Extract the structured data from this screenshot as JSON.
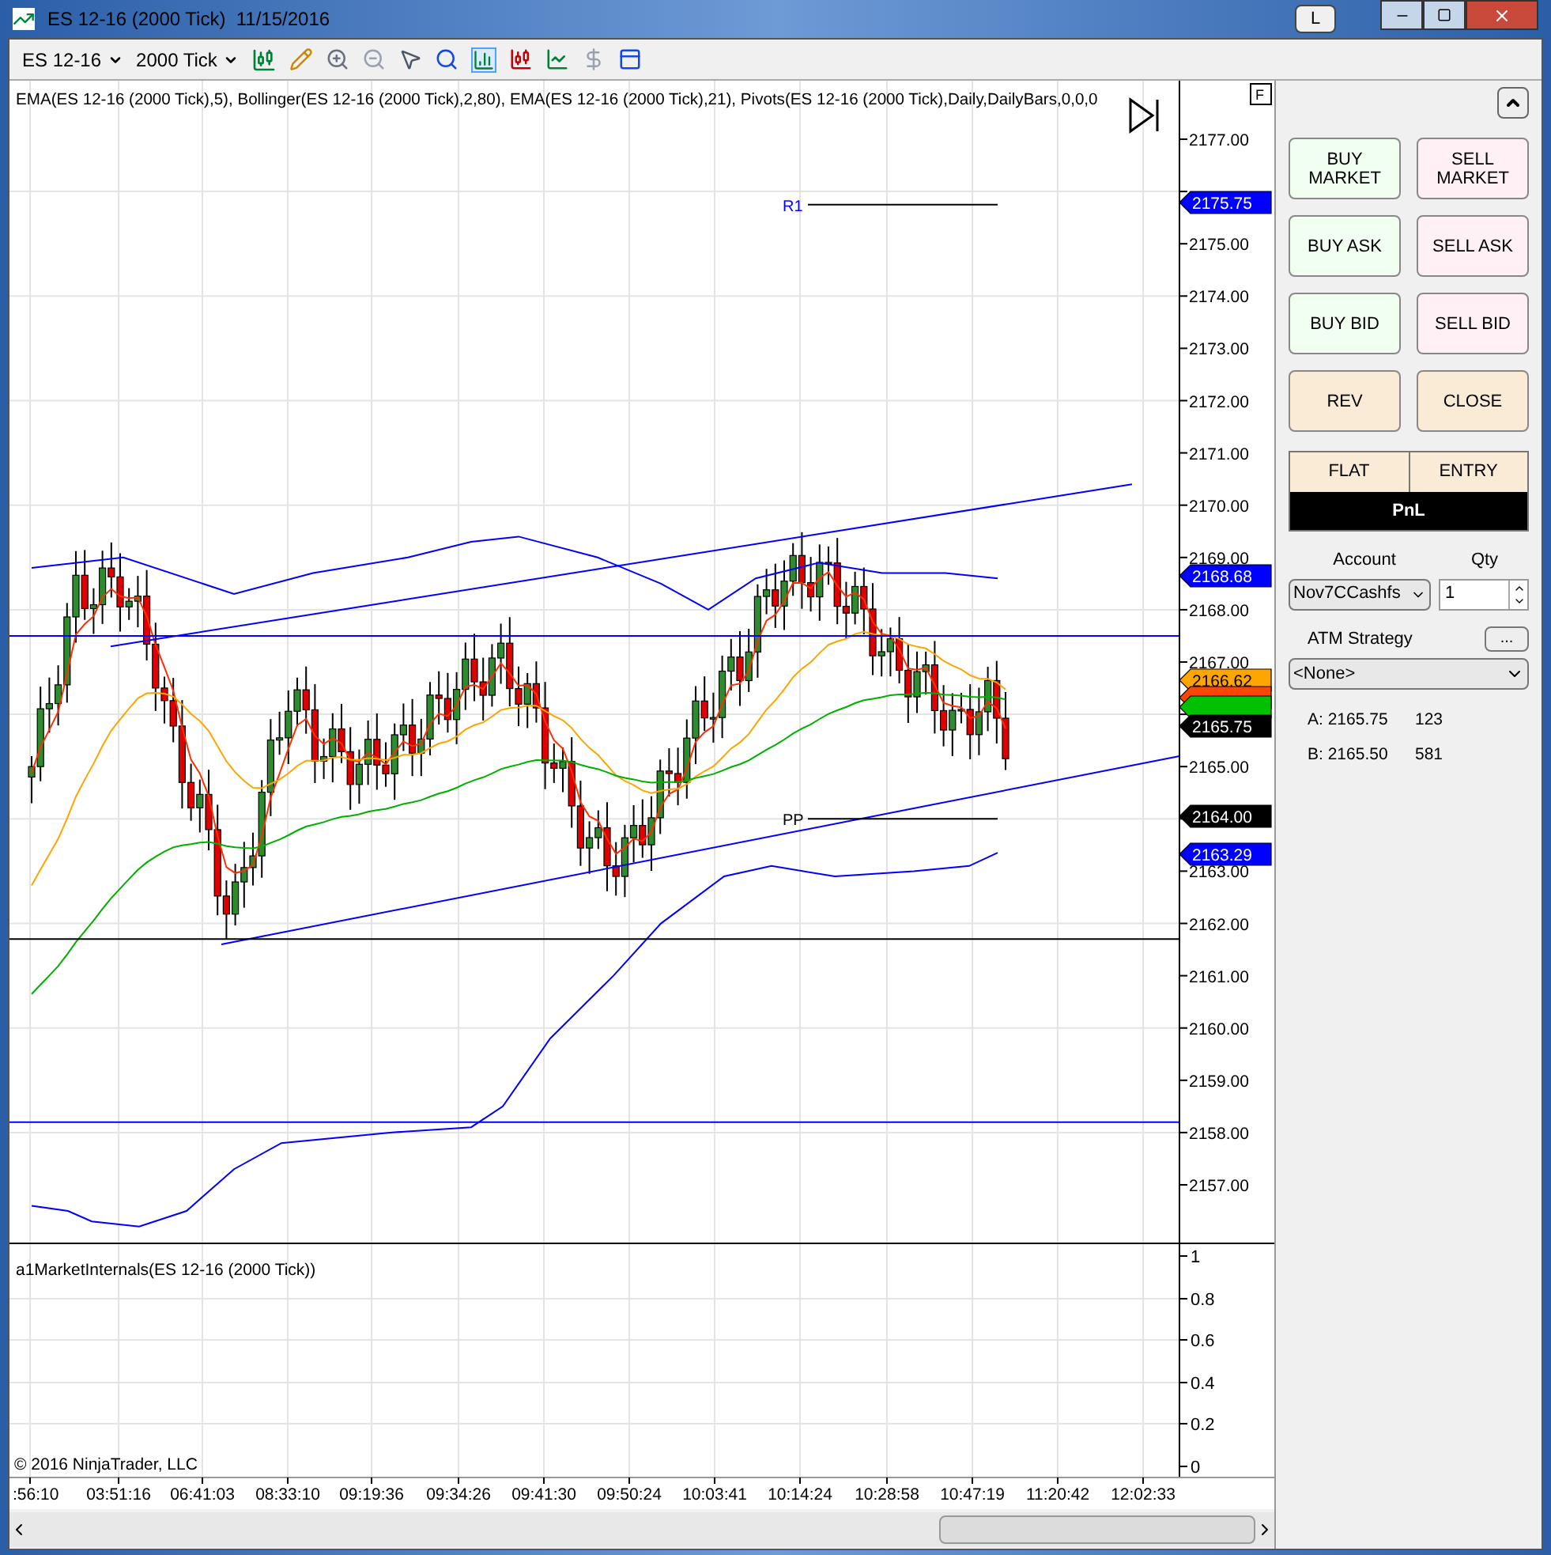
{
  "window": {
    "title": "ES 12-16 (2000 Tick)  11/15/2016",
    "layout_button": "L"
  },
  "toolbar": {
    "instrument": "ES 12-16",
    "interval": "2000 Tick"
  },
  "chart": {
    "indicators": "EMA(ES 12-16 (2000 Tick),5), Bollinger(ES 12-16 (2000 Tick),2,80), EMA(ES 12-16 (2000 Tick),21), Pivots(ES 12-16 (2000 Tick),Daily,DailyBars,0,0,0",
    "f_button": "F",
    "price_labels": [
      "2177.00",
      "2175.00",
      "2174.00",
      "2173.00",
      "2172.00",
      "2171.00",
      "2170.00",
      "2169.00",
      "2168.00",
      "2167.00",
      "2165.00",
      "2163.00",
      "2162.00",
      "2161.00",
      "2160.00",
      "2159.00",
      "2158.00",
      "2157.00"
    ],
    "price_tags": [
      {
        "text": "2175.75",
        "color": "#0000ff"
      },
      {
        "text": "2168.68",
        "color": "#0000ff"
      },
      {
        "text": "2166.62",
        "color": "#ffa500"
      },
      {
        "color": "#ff4500"
      },
      {
        "color": "#00c000"
      },
      {
        "text": "2165.75",
        "color": "#000000"
      },
      {
        "text": "2164.00",
        "color": "#000000"
      },
      {
        "text": "2163.29",
        "color": "#0000ff"
      }
    ],
    "pivot_labels": [
      {
        "text": "R1",
        "color": "#0000ff"
      },
      {
        "text": "PP",
        "color": "#000000"
      }
    ],
    "subpanel": {
      "title": "a1MarketInternals(ES 12-16 (2000 Tick))",
      "axis_labels": [
        "1",
        "0.8",
        "0.6",
        "0.4",
        "0.2",
        "0"
      ]
    },
    "copyright": "© 2016 NinjaTrader, LLC",
    "time_labels": [
      ":56:10",
      "03:51:16",
      "06:41:03",
      "08:33:10",
      "09:19:36",
      "09:34:26",
      "09:41:30",
      "09:50:24",
      "10:03:41",
      "10:14:24",
      "10:28:58",
      "10:47:19",
      "11:20:42",
      "12:02:33"
    ]
  },
  "order_panel": {
    "buttons": [
      {
        "label": "BUY MARKET",
        "kind": "buy"
      },
      {
        "label": "SELL MARKET",
        "kind": "sell"
      },
      {
        "label": "BUY ASK",
        "kind": "buy"
      },
      {
        "label": "SELL ASK",
        "kind": "sell"
      },
      {
        "label": "BUY BID",
        "kind": "buy"
      },
      {
        "label": "SELL BID",
        "kind": "sell"
      },
      {
        "label": "REV",
        "kind": "neutral"
      },
      {
        "label": "CLOSE",
        "kind": "neutral"
      }
    ],
    "position": {
      "flat": "FLAT",
      "entry": "ENTRY",
      "pnl": "PnL"
    },
    "account_label": "Account",
    "account": "Nov7CCashfs",
    "qty_label": "Qty",
    "qty": "1",
    "atm_label": "ATM Strategy",
    "atm_button": "...",
    "atm": "<None>",
    "quotes": [
      {
        "price": "A: 2165.75",
        "size": "123"
      },
      {
        "price": "B: 2165.50",
        "size": "581"
      }
    ]
  }
}
